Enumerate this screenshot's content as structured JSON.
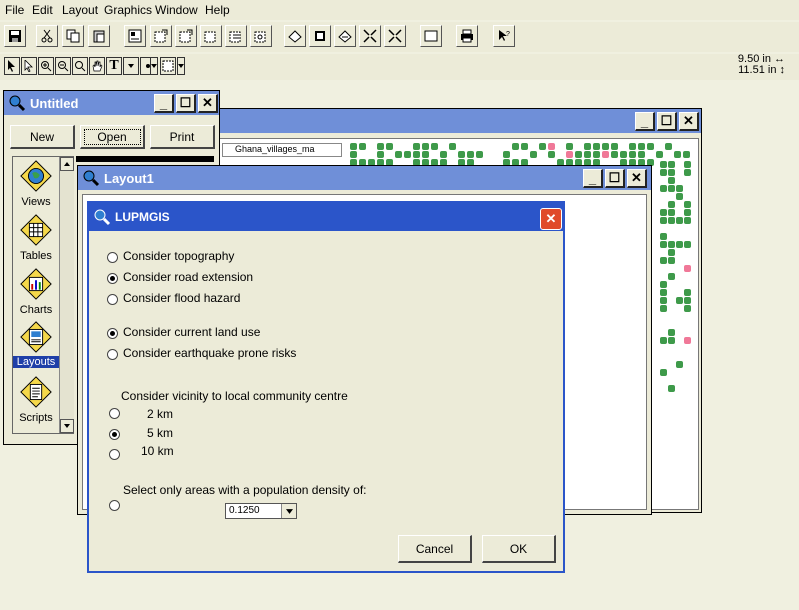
{
  "menu": [
    "File",
    "Edit",
    "Layout",
    "Graphics",
    "Window",
    "Help"
  ],
  "coords": {
    "x": "9.50 in",
    "y": "11.51 in",
    "x_arrow": "↔",
    "y_arrow": "↕"
  },
  "project_window": {
    "title": "Untitled",
    "buttons": {
      "new": "New",
      "open": "Open",
      "print": "Print"
    },
    "items": [
      {
        "label": "Views",
        "icon": "globe-icon"
      },
      {
        "label": "Tables",
        "icon": "table-icon"
      },
      {
        "label": "Charts",
        "icon": "chart-icon"
      },
      {
        "label": "Layouts",
        "icon": "layout-icon"
      },
      {
        "label": "Scripts",
        "icon": "script-icon"
      }
    ],
    "selected": "Layouts"
  },
  "view_window": {
    "layer_label": "Ghana_villages_ma"
  },
  "layout_window": {
    "title": "Layout1"
  },
  "dialog": {
    "title": "LUPMGIS",
    "options": [
      {
        "label": "Consider topography",
        "checked": false
      },
      {
        "label": "Consider road extension",
        "checked": true
      },
      {
        "label": "Consider flood hazard",
        "checked": false
      },
      {
        "label": "Consider current land use",
        "checked": true
      },
      {
        "label": "Consider earthquake prone risks",
        "checked": false
      }
    ],
    "vicinity_label": "Consider vicinity to local community centre",
    "vicinity_options": [
      {
        "label": "2 km",
        "checked": false
      },
      {
        "label": "5 km",
        "checked": true
      },
      {
        "label": "10 km",
        "checked": false
      }
    ],
    "density_label": "Select only areas with a population density of:",
    "density_checked": false,
    "density_value": "0.1250",
    "cancel": "Cancel",
    "ok": "OK"
  },
  "colors": {
    "titlebar": "#6f8fd8",
    "face": "#ecebd8",
    "dot_green": "#3e9a4a",
    "dot_pink": "#f07898",
    "close_red": "#e04a2a"
  }
}
